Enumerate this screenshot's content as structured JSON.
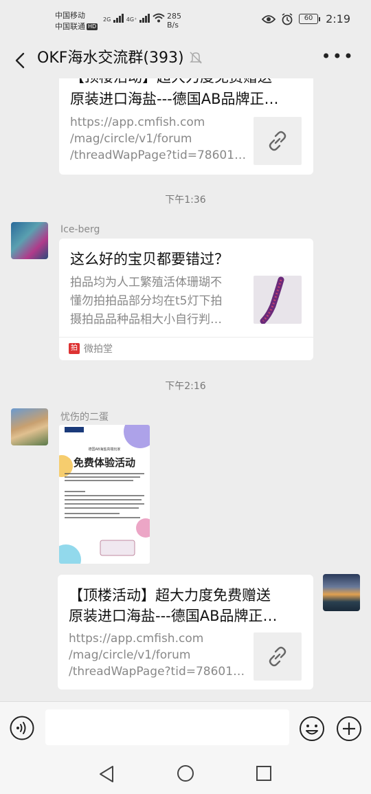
{
  "status_bar": {
    "carrier1": "中国移动",
    "carrier2": "中国联通",
    "hd_badge": "HD",
    "net1": "2G",
    "net2": "4G⁺",
    "speed_value": "285",
    "speed_unit": "B/s",
    "battery": "60",
    "time": "2:19"
  },
  "titlebar": {
    "title": "OKF海水交流群(393)"
  },
  "messages": [
    {
      "type": "link_card",
      "title_line1": "【顶楼活动】超大力度免费赠送",
      "title_line2": "原装进口海盐---德国AB品牌正…",
      "url_line1": "https://app.cmfish.com",
      "url_line2": "/mag/circle/v1/forum",
      "url_line3": "/threadWapPage?tid=78601…"
    },
    {
      "type": "time",
      "text": "下午1:36"
    },
    {
      "type": "mini_program_card",
      "sender": "Ice-berg",
      "title": "这么好的宝贝都要错过？",
      "desc_line1": "拍品均为人工繁殖活体珊瑚不",
      "desc_line2": "懂勿拍拍品部分均在t5灯下拍",
      "desc_line3": "摄拍品品种品相大小自行判…",
      "source": "微拍堂"
    },
    {
      "type": "time",
      "text": "下午2:16"
    },
    {
      "type": "image",
      "sender": "忧伤的二蛋",
      "poster_sub": "德国AB海盐高端玩家",
      "poster_heading": "免费体验活动"
    },
    {
      "type": "link_card_self",
      "title_line1": "【顶楼活动】超大力度免费赠送",
      "title_line2": "原装进口海盐---德国AB品牌正…",
      "url_line1": "https://app.cmfish.com",
      "url_line2": "/mag/circle/v1/forum",
      "url_line3": "/threadWapPage?tid=78601…"
    }
  ],
  "input": {
    "value": ""
  },
  "colors": {
    "background": "#ededed",
    "card": "#ffffff",
    "meta_text": "#888888"
  }
}
